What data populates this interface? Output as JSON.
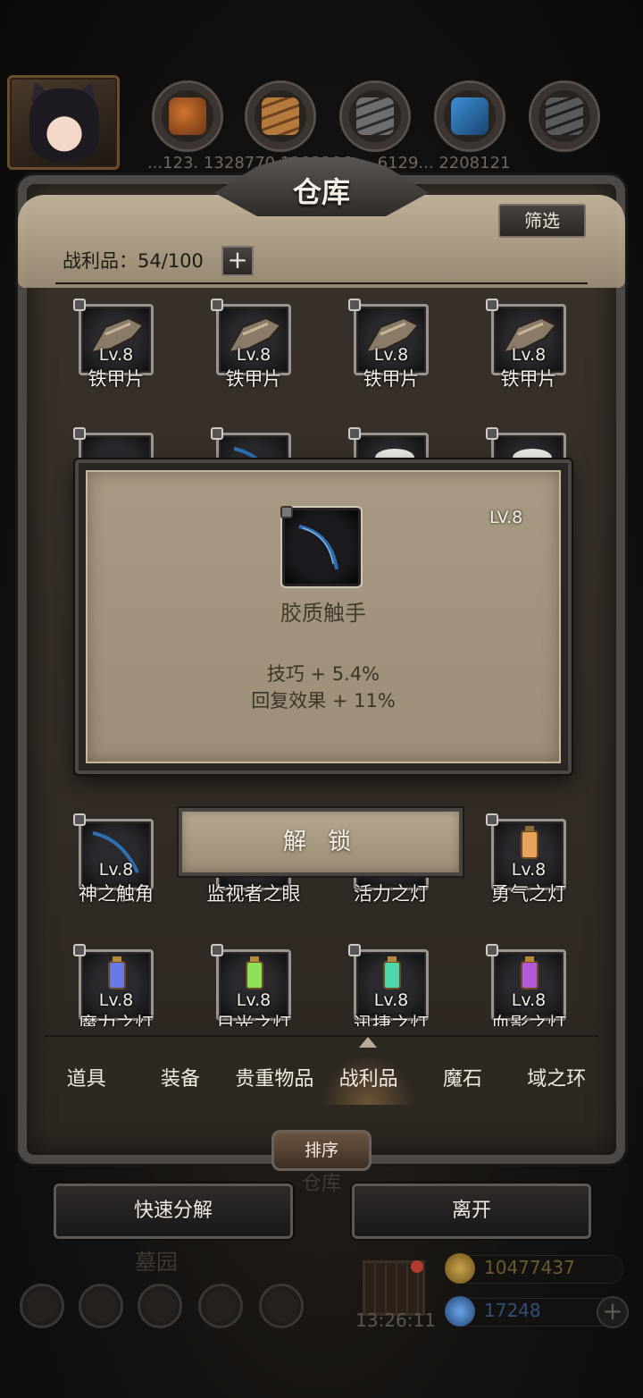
{
  "top_bar": {
    "resource_values": "...123. 1328770 1293286 ... 6129... 2208121"
  },
  "panel": {
    "title": "仓库",
    "filter_label": "筛选",
    "capacity": "战利品：54/100",
    "expand_label": "+"
  },
  "items": {
    "row1": [
      {
        "level": "Lv.8",
        "name": "铁甲片"
      },
      {
        "level": "Lv.8",
        "name": "铁甲片"
      },
      {
        "level": "Lv.8",
        "name": "铁甲片"
      },
      {
        "level": "Lv.8",
        "name": "铁甲片"
      }
    ],
    "row4": [
      {
        "level": "Lv.8",
        "name": "神之触角"
      },
      {
        "level": "Lv.8",
        "name": "监视者之眼"
      },
      {
        "level": "Lv.8",
        "name": "活力之灯"
      },
      {
        "level": "Lv.8",
        "name": "勇气之灯"
      }
    ],
    "row5": [
      {
        "level": "Lv.8",
        "name": "魔力之灯"
      },
      {
        "level": "Lv.8",
        "name": "日光之灯"
      },
      {
        "level": "Lv.8",
        "name": "迅捷之灯"
      },
      {
        "level": "Lv.8",
        "name": "血影之灯"
      }
    ]
  },
  "tooltip": {
    "level": "LV.8",
    "item_name": "胶质触手",
    "stats": [
      "技巧 + 5.4%",
      "回复效果 + 11%"
    ],
    "unlock_label": "解 锁"
  },
  "tabs": [
    "道具",
    "装备",
    "贵重物品",
    "战利品",
    "魔石",
    "域之环"
  ],
  "active_tab": "战利品",
  "sort_label": "排序",
  "behind_title": "仓库",
  "buttons": {
    "quick_decompose": "快速分解",
    "leave": "离开"
  },
  "hud": {
    "cemetery": "墓园",
    "clock": "13:26:11",
    "gold": "10477437",
    "gems": "17248"
  },
  "colors": {
    "panel_parchment": "#a89a82",
    "panel_frame": "#4d4947",
    "text_light": "#f4efe9",
    "gold_text": "#6b5a2e",
    "gem_text": "#2f4f78"
  },
  "icons": {
    "lock": "lock-icon",
    "gift": "gift-icon",
    "gold": "gold-coin-icon",
    "gem": "gem-icon"
  }
}
